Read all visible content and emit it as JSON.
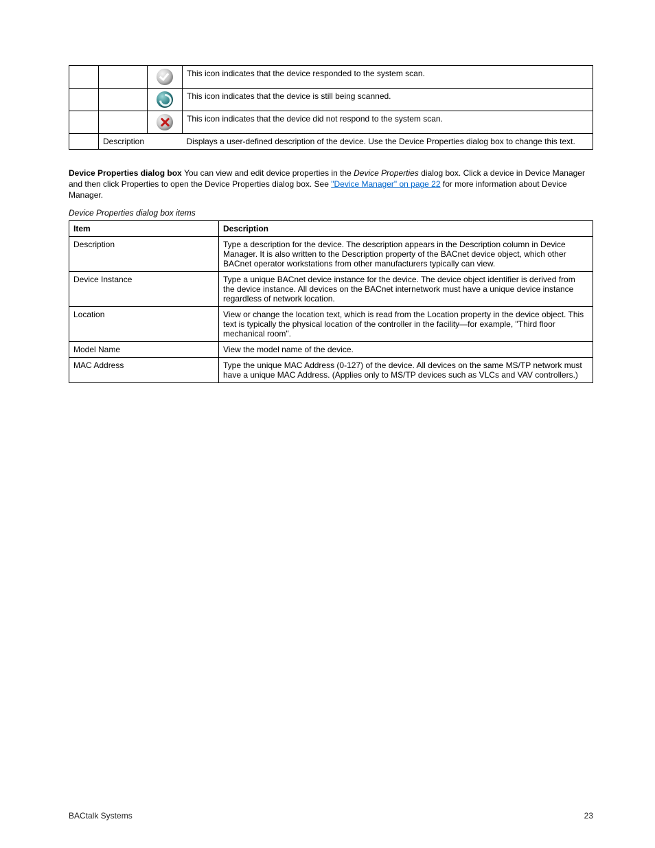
{
  "footer": {
    "left": "BACtalk Systems",
    "right": "23"
  },
  "table1": {
    "rows": [
      {
        "icon": "check",
        "desc": "This icon indicates that the device responded to the system scan."
      },
      {
        "icon": "refresh",
        "desc": "This icon indicates that the device is still being scanned."
      },
      {
        "icon": "x",
        "desc": "This icon indicates that the device did not respond to the system scan."
      }
    ],
    "lastRow": {
      "label": "Description",
      "desc": "Displays a user-defined description of the device. Use the Device Properties dialog box to change this text."
    }
  },
  "paragraph": {
    "lead": "Device Properties dialog box  ",
    "body_a": "You can view and edit device properties in the ",
    "term": "Device Properties",
    "body_b": " dialog box. Click a device in Device Manager and then click Properties to open the Device Properties dialog box. See ",
    "link_text": "\"Device Manager\" on page 22",
    "body_c": " for more information about Device Manager."
  },
  "table2": {
    "caption": "Device Properties dialog box items",
    "headers": [
      "Item",
      "Description"
    ],
    "rows": [
      {
        "item": "Description",
        "desc": "Type a description for the device. The description appears in the Description column in Device Manager. It is also written to the Description property of the BACnet device object, which other BACnet operator workstations from other manufacturers typically can view."
      },
      {
        "item": "Device Instance",
        "desc": "Type a unique BACnet device instance for the device. The device object identifier is derived from the device instance. All devices on the BACnet internetwork must have a unique device instance regardless of network location."
      },
      {
        "item": "Location",
        "desc": "View or change the location text, which is read from the Location property in the device object. This text is typically the physical location of the controller in the facility—for example, \"Third floor mechanical room\"."
      },
      {
        "item": "Model Name",
        "desc": "View the model name of the device."
      },
      {
        "item": "MAC Address",
        "desc": "Type the unique MAC Address (0-127) of the device. All devices on the same MS/TP network must have a unique MAC Address. (Applies only to MS/TP devices such as VLCs and VAV controllers.)"
      }
    ]
  }
}
